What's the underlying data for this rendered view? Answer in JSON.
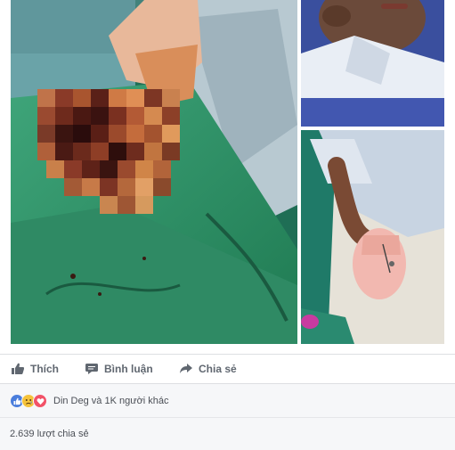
{
  "post": {
    "photos": [
      {
        "name": "injured-hand-photo"
      },
      {
        "name": "child-face-photo"
      },
      {
        "name": "bandaged-hand-photo"
      }
    ]
  },
  "actions": {
    "like_label": "Thích",
    "comment_label": "Bình luận",
    "share_label": "Chia sẻ"
  },
  "reactions": {
    "icons": [
      "like-icon",
      "sad-icon",
      "love-icon"
    ],
    "summary": "Din Deg và 1K người khác"
  },
  "shares": {
    "text": "2.639 lượt chia sẻ"
  },
  "colors": {
    "action_text": "#606770",
    "like_blue": "#4a7ddc",
    "love_red": "#f25268",
    "sad_yellow": "#f5c33b",
    "footer_bg": "#f6f7f9"
  }
}
